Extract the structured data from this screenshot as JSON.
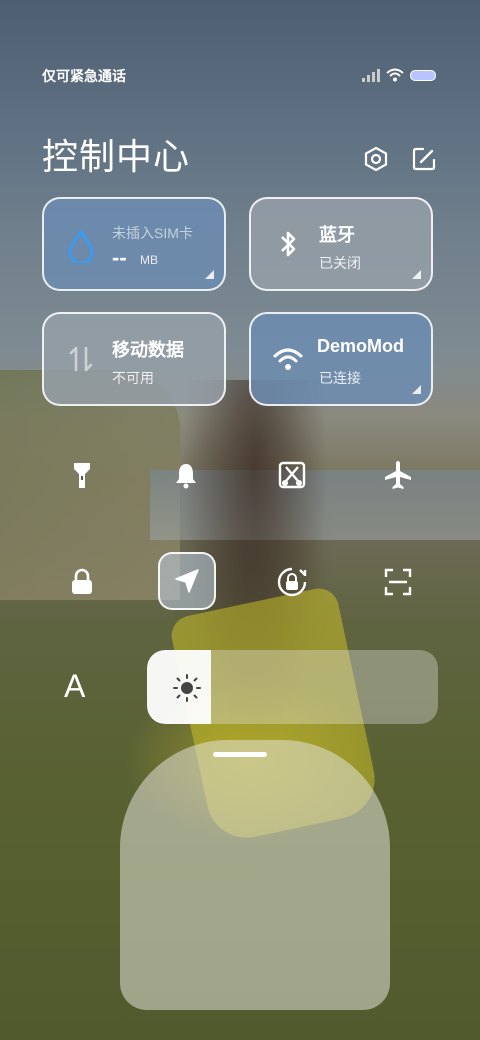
{
  "status_bar": {
    "carrier": "仅可紧急通话"
  },
  "header": {
    "title": "控制中心"
  },
  "tiles": [
    {
      "main": "未插入SIM卡",
      "value": "--",
      "unit": "MB"
    },
    {
      "main": "蓝牙",
      "sub": "已关闭"
    },
    {
      "main": "移动数据",
      "sub": "不可用"
    },
    {
      "main": "DemoMod",
      "sub": "已连接"
    }
  ],
  "quick_toggles": [
    "flashlight",
    "silent",
    "screenshot",
    "airplane",
    "lock",
    "location",
    "rotation-lock",
    "scanner"
  ],
  "brightness": {
    "level": 0.22,
    "auto_label": "A"
  },
  "colors": {
    "tile_active": "#6c8cb0",
    "tile_inactive": "#96a0a8",
    "battery": "#b7c4ff"
  }
}
